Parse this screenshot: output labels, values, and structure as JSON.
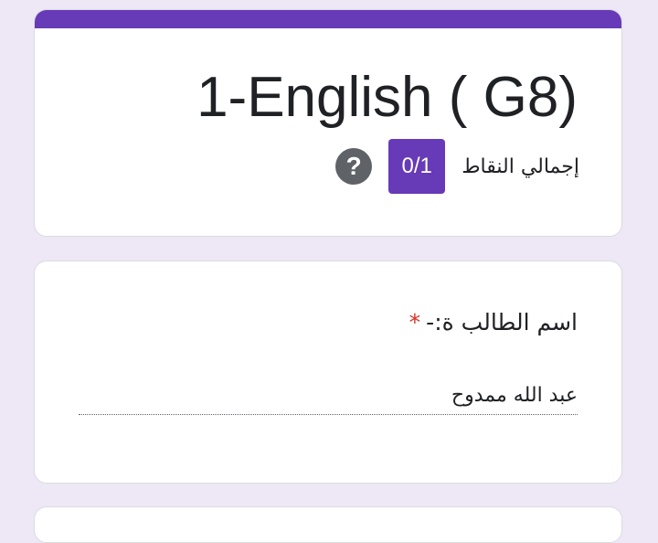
{
  "form": {
    "title": "1-English ( G8)",
    "accent_color": "#673ab7",
    "score": {
      "label": "إجمالي النقاط",
      "value": "0/1",
      "help_symbol": "?"
    }
  },
  "question": {
    "title": "اسم الطالب ة:-",
    "required_marker": "*",
    "answer": "عبد الله ممدوح"
  }
}
